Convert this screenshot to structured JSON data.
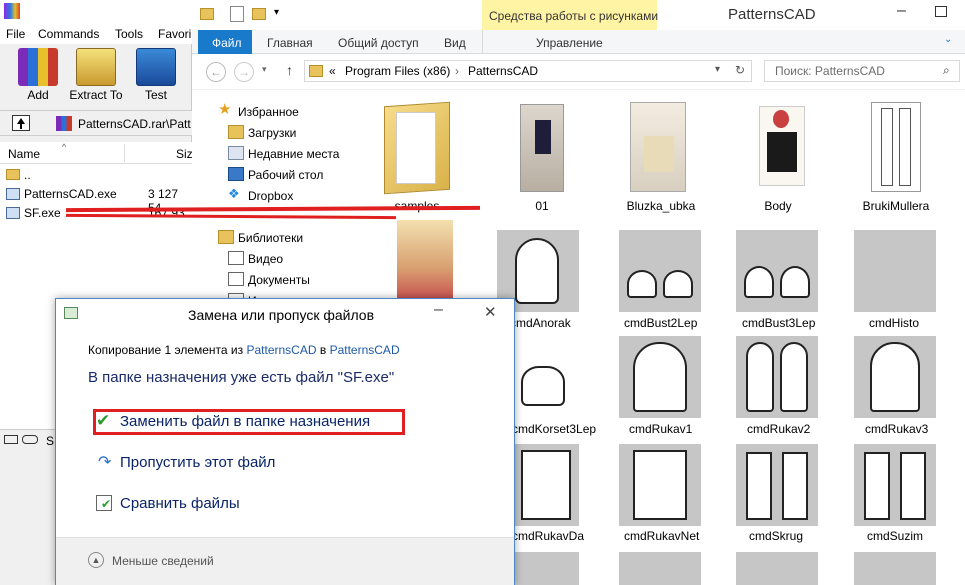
{
  "winrar": {
    "menu": [
      "File",
      "Commands",
      "Tools",
      "Favori"
    ],
    "toolbar": [
      {
        "label": "Add",
        "icon": "add-archive-icon"
      },
      {
        "label": "Extract To",
        "icon": "extract-to-icon"
      },
      {
        "label": "Test",
        "icon": "test-archive-icon"
      }
    ],
    "path": "PatternsCAD.rar\\Patt",
    "columns": {
      "name": "Name",
      "size": "Siz"
    },
    "files": [
      {
        "name": "..",
        "size": ""
      },
      {
        "name": "PatternsCAD.exe",
        "size": "3 127 54"
      },
      {
        "name": "SF.exe",
        "size": "167 93"
      }
    ],
    "status_letter": "S"
  },
  "explorer": {
    "title": "PatternsCAD",
    "contextual_tab": "Средства работы с рисунками",
    "ribbon_tabs": [
      "Файл",
      "Главная",
      "Общий доступ",
      "Вид"
    ],
    "contextual_sub": "Управление",
    "breadcrumb": [
      "«",
      "Program Files (x86)",
      "PatternsCAD"
    ],
    "search_placeholder": "Поиск: PatternsCAD",
    "nav": {
      "favorites": "Избранное",
      "downloads": "Загрузки",
      "recent": "Недавние места",
      "desktop": "Рабочий стол",
      "dropbox": "Dropbox",
      "libraries": "Библиотеки",
      "video": "Видео",
      "documents": "Документы",
      "images": "Изо"
    },
    "tiles_row1": [
      "samples",
      "01",
      "Bluzka_ubka",
      "Body",
      "BrukiMullera"
    ],
    "tiles_row2": [
      "cmdAnorak",
      "cmdBust2Lep",
      "cmdBust3Lep",
      "cmdHisto"
    ],
    "tiles_row3": [
      "cmdKorset3Lep",
      "cmdRukav1",
      "cmdRukav2",
      "cmdRukav3"
    ],
    "tiles_row4": [
      "cmdRukavDa",
      "cmdRukavNet",
      "cmdSkrug",
      "cmdSuzim"
    ]
  },
  "dialog": {
    "title": "Замена или пропуск файлов",
    "copy_prefix": "Копирование 1 элемента из",
    "copy_from": "PatternsCAD",
    "copy_mid": "в",
    "copy_to": "PatternsCAD",
    "message": "В папке назначения уже есть файл \"SF.exe\"",
    "options": {
      "replace": "Заменить файл в папке назначения",
      "skip": "Пропустить этот файл",
      "compare": "Сравнить файлы"
    },
    "less_details": "Меньше сведений"
  },
  "colors": {
    "accent": "#1979ca",
    "contextual": "#fff3a4",
    "annotation": "#e02020",
    "link": "#1c5aa6"
  }
}
